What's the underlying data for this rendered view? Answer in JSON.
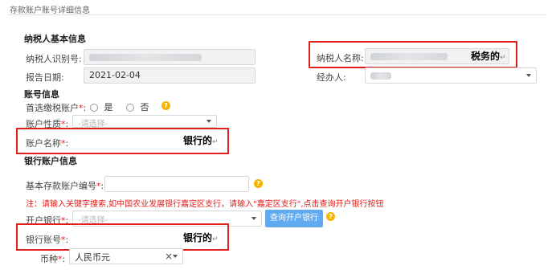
{
  "page": {
    "title": "存款账户账号详细信息"
  },
  "taxpayer": {
    "section_title": "纳税人基本信息",
    "id_label": "纳税人识别号:",
    "name_label": "纳税人名称:",
    "name_annotation": "税务的",
    "report_date_label": "报告日期:",
    "report_date_value": "2021-02-04",
    "handler_label": "经办人:"
  },
  "account": {
    "section_title": "账号信息",
    "preferred_label": "首选缴税账户",
    "preferred_yes": "是",
    "preferred_no": "否",
    "type_label": "账户性质",
    "type_placeholder": "-请选择-",
    "name_label": "账户名称",
    "name_annotation": "银行的"
  },
  "bank": {
    "section_title": "银行账户信息",
    "basic_no_label": "基本存款账户编号",
    "notice": "注：请输入关键字搜索,如中国农业发展银行嘉定区支行，请输入\"嘉定区支行\",点击查询开户银行按钮",
    "open_bank_label": "开户银行",
    "open_bank_placeholder": "-请选择-",
    "query_button": "查询开户银行",
    "account_no_label": "银行账号",
    "account_no_annotation": "银行的",
    "currency_label": "币种",
    "currency_value": "人民币元",
    "clear_icon": "×"
  },
  "symbols": {
    "required": "*",
    "colon": ":",
    "return_mark": "↵",
    "help": "?"
  },
  "colors": {
    "highlight": "#e0201c",
    "help_icon": "#f5b400",
    "button": "#62aaf0"
  }
}
